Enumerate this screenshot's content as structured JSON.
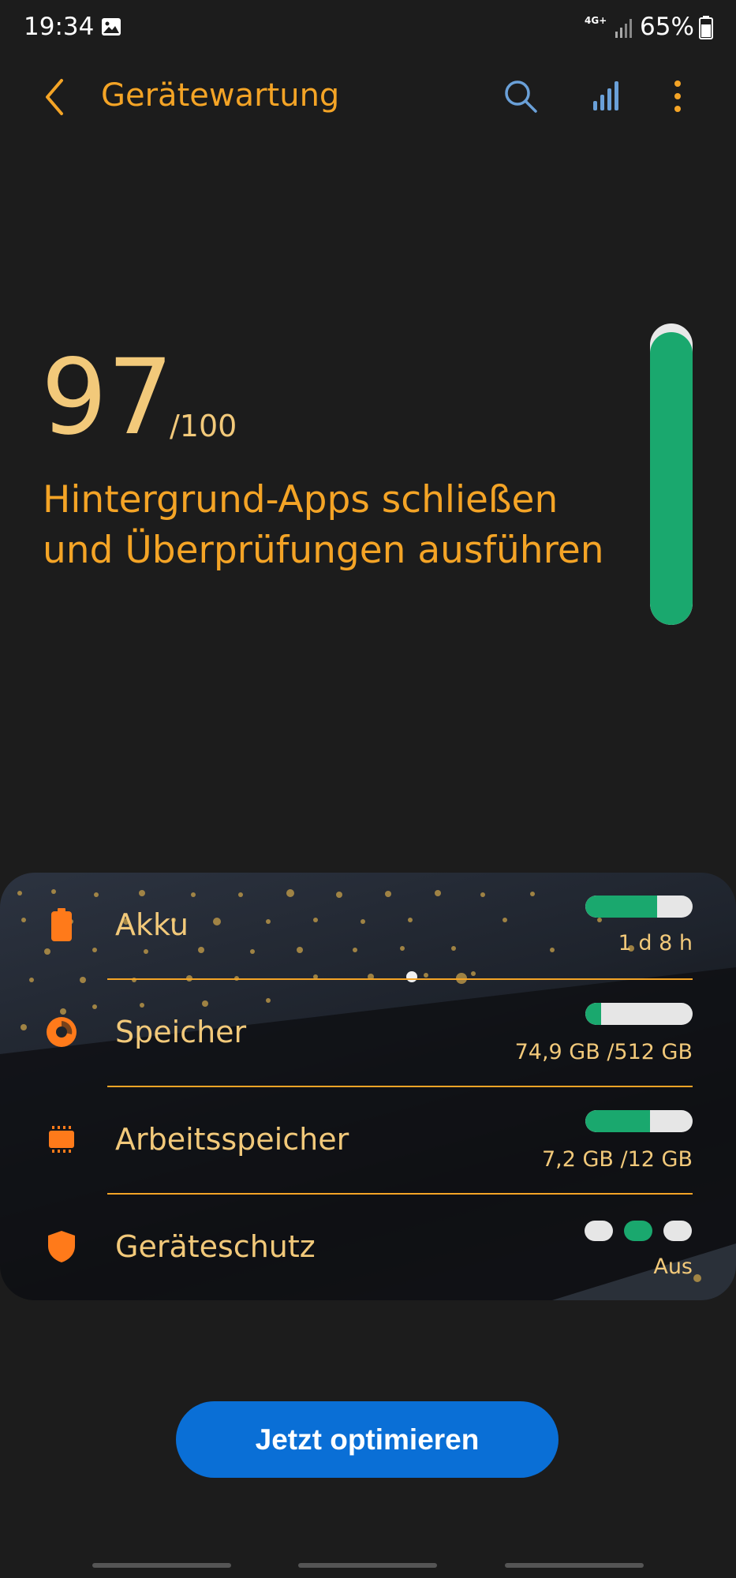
{
  "status_bar": {
    "time": "19:34",
    "network": "4G+",
    "battery": "65%"
  },
  "header": {
    "title": "Gerätewartung",
    "accent_color": "#f4a426",
    "icon_color": "#6aa0d8"
  },
  "score": {
    "value": "97",
    "max": "/100",
    "message": "Hintergrund-Apps schließen und Überprüfungen ausführen",
    "fill_fraction": 0.97,
    "bar_color": "#1aa86e"
  },
  "items": [
    {
      "label": "Akku",
      "value": "1 d 8 h",
      "icon": "battery-icon",
      "fill_fraction": 0.67
    },
    {
      "label": "Speicher",
      "value": "74,9 GB /512 GB",
      "icon": "storage-pie-icon",
      "fill_fraction": 0.146
    },
    {
      "label": "Arbeitsspeicher",
      "value": "7,2 GB /12 GB",
      "icon": "memory-chip-icon",
      "fill_fraction": 0.6
    },
    {
      "label": "Geräteschutz",
      "value": "Aus",
      "icon": "shield-icon",
      "active_dot": 2
    }
  ],
  "optimize_button": {
    "label": "Jetzt optimieren",
    "color": "#0a6fd6"
  }
}
